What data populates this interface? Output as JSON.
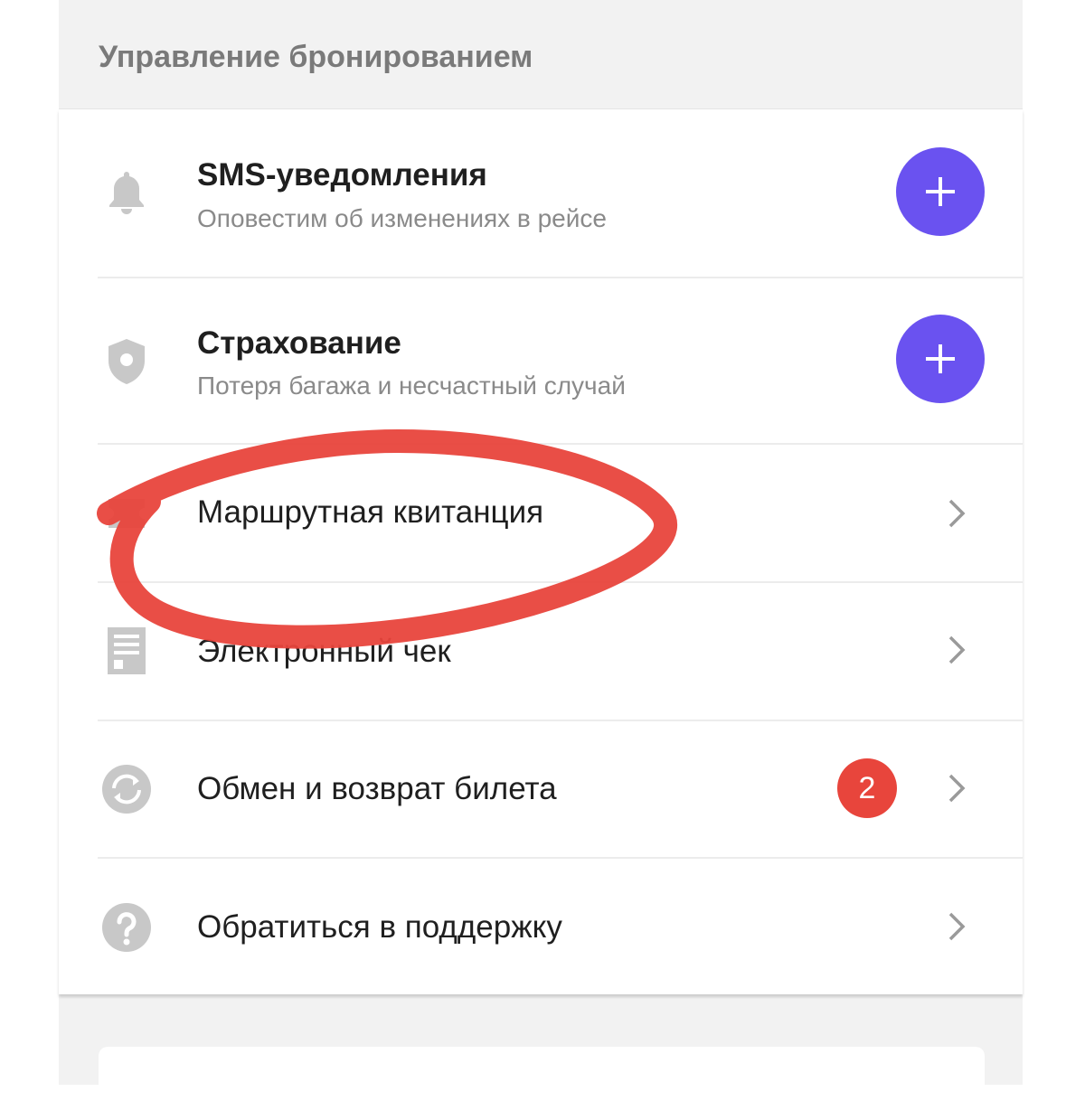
{
  "header": {
    "title": "Управление бронированием"
  },
  "items": [
    {
      "title": "SMS-уведомления",
      "subtitle": "Оповестим об изменениях в рейсе",
      "icon": "bell-icon",
      "action": "add"
    },
    {
      "title": "Страхование",
      "subtitle": "Потеря багажа и несчастный случай",
      "icon": "shield-icon",
      "action": "add"
    },
    {
      "title": "Маршрутная квитанция",
      "icon": "ticket-icon",
      "action": "chevron"
    },
    {
      "title": "Электронный чек",
      "icon": "receipt-icon",
      "action": "chevron"
    },
    {
      "title": "Обмен и возврат билета",
      "icon": "exchange-icon",
      "action": "chevron",
      "badge": "2"
    },
    {
      "title": "Обратиться в поддержку",
      "icon": "help-icon",
      "action": "chevron"
    }
  ],
  "colors": {
    "accent": "#6a52f0",
    "badge": "#e8453c",
    "annotation": "#e8453c",
    "icon": "#c8c8c8"
  }
}
